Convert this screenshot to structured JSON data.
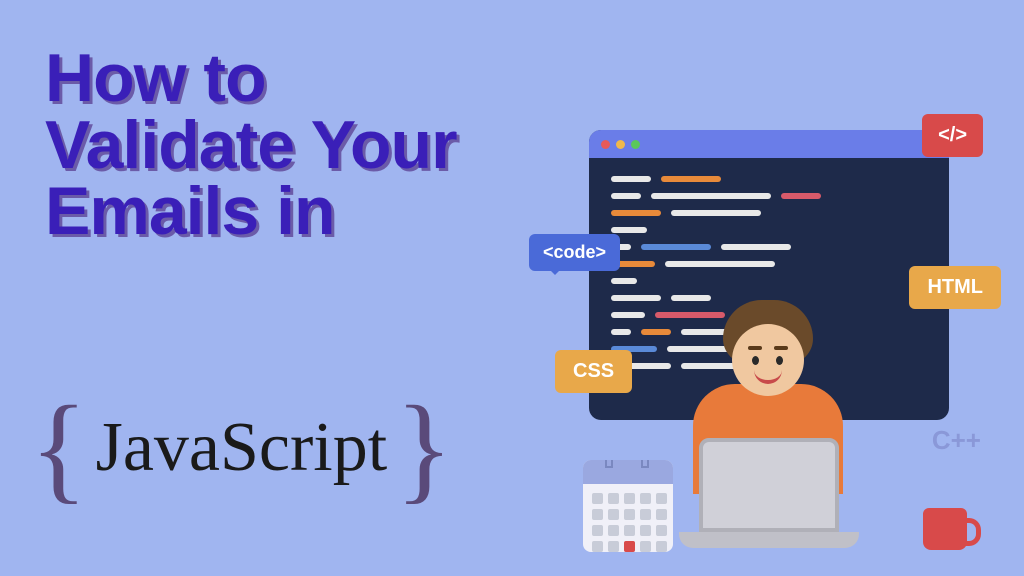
{
  "title": "How to Validate Your Emails in",
  "jslabel": "JavaScript",
  "brace_left": "{",
  "brace_right": "}",
  "tags": {
    "code": "<code>",
    "slash": "</>",
    "html": "HTML",
    "css": "CSS",
    "cpp": "C++"
  }
}
